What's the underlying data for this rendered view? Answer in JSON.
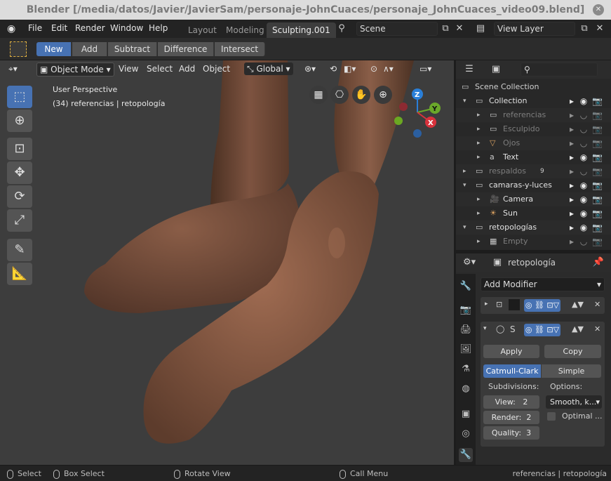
{
  "window_title": "Blender [/media/datos/Javier/JavierSam/personaje-JohnCuaces/personaje_JohnCuaces_video09.blend]",
  "menu": [
    "File",
    "Edit",
    "Render",
    "Window",
    "Help"
  ],
  "workspaces": [
    "Layout",
    "Modeling",
    "Sculpting.001"
  ],
  "scene": "Scene",
  "view_layer": "View Layer",
  "boolean_ops": [
    "New",
    "Add",
    "Subtract",
    "Difference",
    "Intersect"
  ],
  "viewport": {
    "mode": "Object Mode",
    "menus": [
      "View",
      "Select",
      "Add",
      "Object"
    ],
    "orientation": "Global",
    "overlay_title": "User Perspective",
    "overlay_sub": "(34) referencias | retopología"
  },
  "gizmo": {
    "z": "Z",
    "y": "Y",
    "x": "X"
  },
  "outliner": {
    "root": "Scene Collection",
    "rows": [
      {
        "name": "Collection",
        "kind": "collection"
      },
      {
        "name": "referencias",
        "kind": "item-dim"
      },
      {
        "name": "Esculpido",
        "kind": "item-dim"
      },
      {
        "name": "Ojos",
        "kind": "item-dim"
      },
      {
        "name": "Text",
        "kind": "item"
      },
      {
        "name": "respaldos",
        "kind": "collection-dim"
      },
      {
        "name": "camaras-y-luces",
        "kind": "collection"
      },
      {
        "name": "Camera",
        "kind": "item"
      },
      {
        "name": "Sun",
        "kind": "item"
      },
      {
        "name": "retopologías",
        "kind": "collection"
      },
      {
        "name": "Empty",
        "kind": "item-dim"
      }
    ],
    "respaldos_count": "9"
  },
  "properties": {
    "object_name": "retopología",
    "add_modifier": "Add Modifier",
    "mod2_short": "S",
    "apply": "Apply",
    "copy": "Copy",
    "catmull": "Catmull-Clark",
    "simple": "Simple",
    "subdivisions": "Subdivisions:",
    "options": "Options:",
    "view_label": "View:",
    "view_val": "2",
    "render_label": "Render:",
    "render_val": "2",
    "quality_label": "Quality:",
    "quality_val": "3",
    "smooth": "Smooth, k...",
    "optimal": "Optimal ..."
  },
  "status": {
    "select": "Select",
    "box_select": "Box Select",
    "rotate_view": "Rotate View",
    "call_menu": "Call Menu",
    "right": "referencias | retopología"
  }
}
